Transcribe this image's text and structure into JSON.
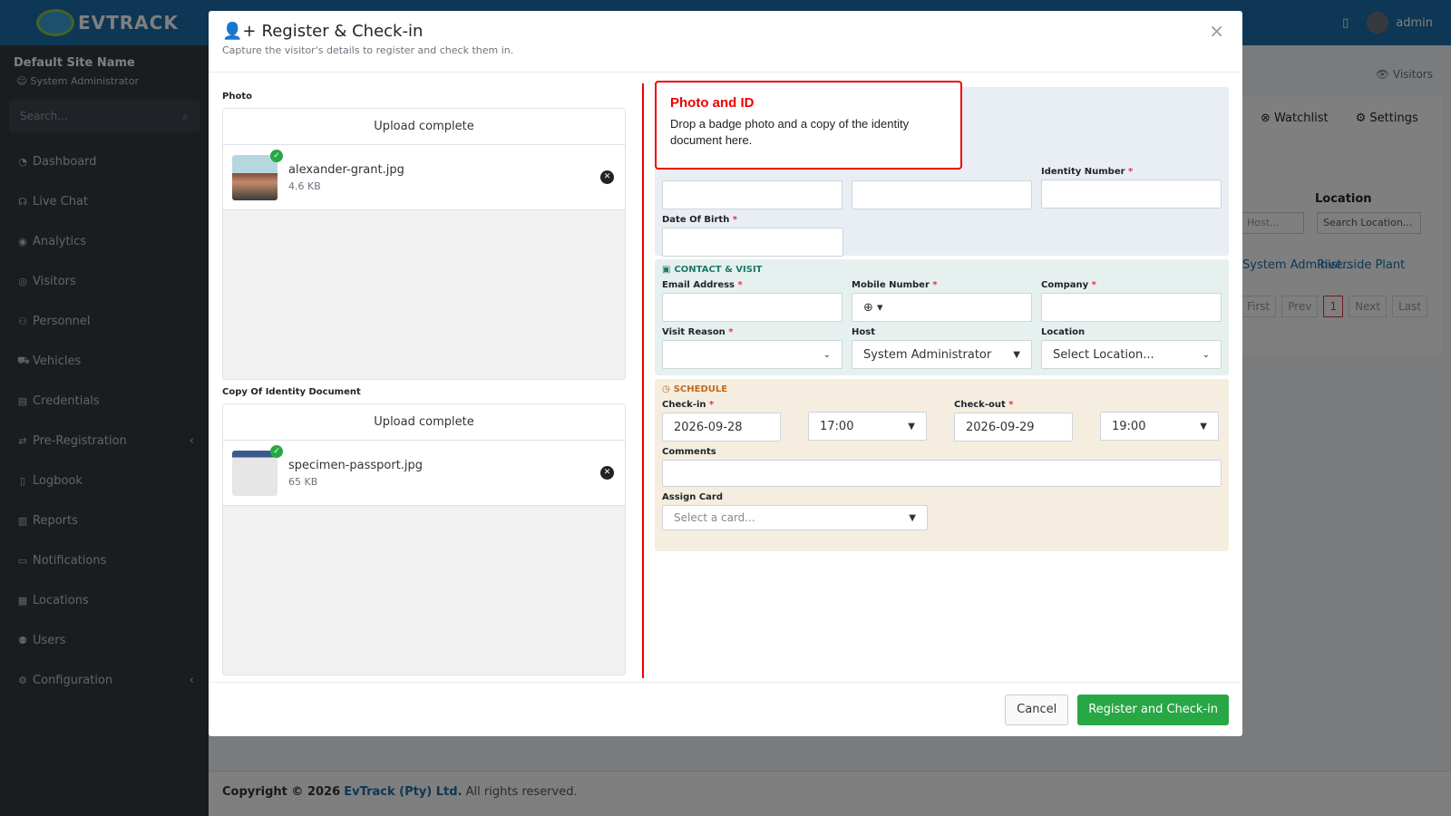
{
  "app": {
    "brand": "EVTRACK",
    "topbar_user": "admin"
  },
  "sidebar": {
    "site_name": "Default Site Name",
    "user_role": "System Administrator",
    "search_placeholder": "Search...",
    "items": [
      {
        "label": "Dashboard",
        "icon": "dashboard-icon"
      },
      {
        "label": "Live Chat",
        "icon": "headset-icon"
      },
      {
        "label": "Analytics",
        "icon": "target-icon"
      },
      {
        "label": "Visitors",
        "icon": "eye-icon"
      },
      {
        "label": "Personnel",
        "icon": "users-icon"
      },
      {
        "label": "Vehicles",
        "icon": "car-icon"
      },
      {
        "label": "Credentials",
        "icon": "id-card-icon"
      },
      {
        "label": "Pre-Registration",
        "icon": "arrows-icon"
      },
      {
        "label": "Logbook",
        "icon": "book-icon"
      },
      {
        "label": "Reports",
        "icon": "chart-icon"
      },
      {
        "label": "Notifications",
        "icon": "bell-icon"
      },
      {
        "label": "Locations",
        "icon": "building-icon"
      },
      {
        "label": "Users",
        "icon": "user-cog-icon"
      },
      {
        "label": "Configuration",
        "icon": "gear-icon"
      }
    ]
  },
  "background": {
    "visitors_crumb": "Visitors",
    "tab_watchlist": "Watchlist",
    "tab_settings": "Settings",
    "location_header": "Location",
    "host_filter": "Host...",
    "location_filter": "Search Location...",
    "row_host": "System Administ...",
    "row_location": "Riverside Plant",
    "pagination": [
      "First",
      "Prev",
      "1",
      "Next",
      "Last"
    ]
  },
  "footer": {
    "copyright": "Copyright © 2026",
    "company": "EvTrack (Pty) Ltd.",
    "rights": "All rights reserved."
  },
  "modal": {
    "title": "Register & Check-in",
    "subtitle": "Capture the visitor's details to register and check them in.",
    "cancel": "Cancel",
    "submit": "Register and Check-in",
    "photo_label": "Photo",
    "photo_status": "Upload complete",
    "photo_file": {
      "name": "alexander-grant.jpg",
      "size": "4.6 KB"
    },
    "idcopy_label": "Copy Of Identity Document",
    "idcopy_status": "Upload complete",
    "idcopy_file": {
      "name": "specimen-passport.jpg",
      "size": "65 KB"
    },
    "identity": {
      "identity_number_label": "Identity Number",
      "dob_label": "Date Of Birth"
    },
    "contact": {
      "heading": "CONTACT & VISIT",
      "email_label": "Email Address",
      "mobile_label": "Mobile Number",
      "company_label": "Company",
      "visit_reason_label": "Visit Reason",
      "host_label": "Host",
      "host_value": "System Administrator",
      "location_label": "Location",
      "location_value": "Select Location..."
    },
    "schedule": {
      "heading": "SCHEDULE",
      "checkin_label": "Check-in",
      "checkin_date": "2026-09-28",
      "checkin_time": "17:00",
      "checkout_label": "Check-out",
      "checkout_date": "2026-09-29",
      "checkout_time": "19:00",
      "comments_label": "Comments",
      "card_label": "Assign Card",
      "card_placeholder": "Select a card..."
    }
  },
  "tooltip": {
    "title": "Photo and ID",
    "body": "Drop a badge photo and a copy of the identity document here."
  },
  "colors": {
    "brand": "#1b6ea8",
    "success": "#28a745",
    "highlight": "#e00000"
  }
}
